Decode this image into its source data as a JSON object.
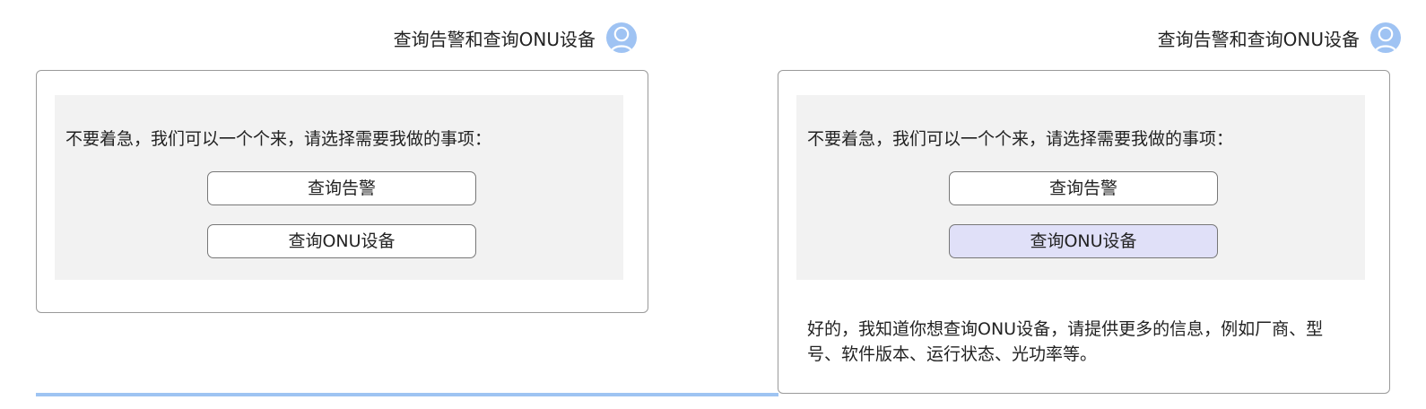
{
  "colors": {
    "avatar": "#9fc3f3",
    "choice_box_bg": "#f2f2f2",
    "selected_button_bg": "#e0e0f8",
    "bottom_line": "#9ec4f2"
  },
  "left_panel": {
    "user_message": "查询告警和查询ONU设备",
    "avatar_icon": "user-avatar-icon",
    "bot": {
      "prompt": "不要着急，我们可以一个个来，请选择需要我做的事项：",
      "options": [
        "查询告警",
        "查询ONU设备"
      ],
      "selected_option": ""
    }
  },
  "right_panel": {
    "user_message": "查询告警和查询ONU设备",
    "avatar_icon": "user-avatar-icon",
    "bot": {
      "prompt": "不要着急，我们可以一个个来，请选择需要我做的事项：",
      "options": [
        "查询告警",
        "查询ONU设备"
      ],
      "selected_option": "查询ONU设备",
      "reply": "好的，我知道你想查询ONU设备，请提供更多的信息，例如厂商、型号、软件版本、运行状态、光功率等。"
    }
  }
}
